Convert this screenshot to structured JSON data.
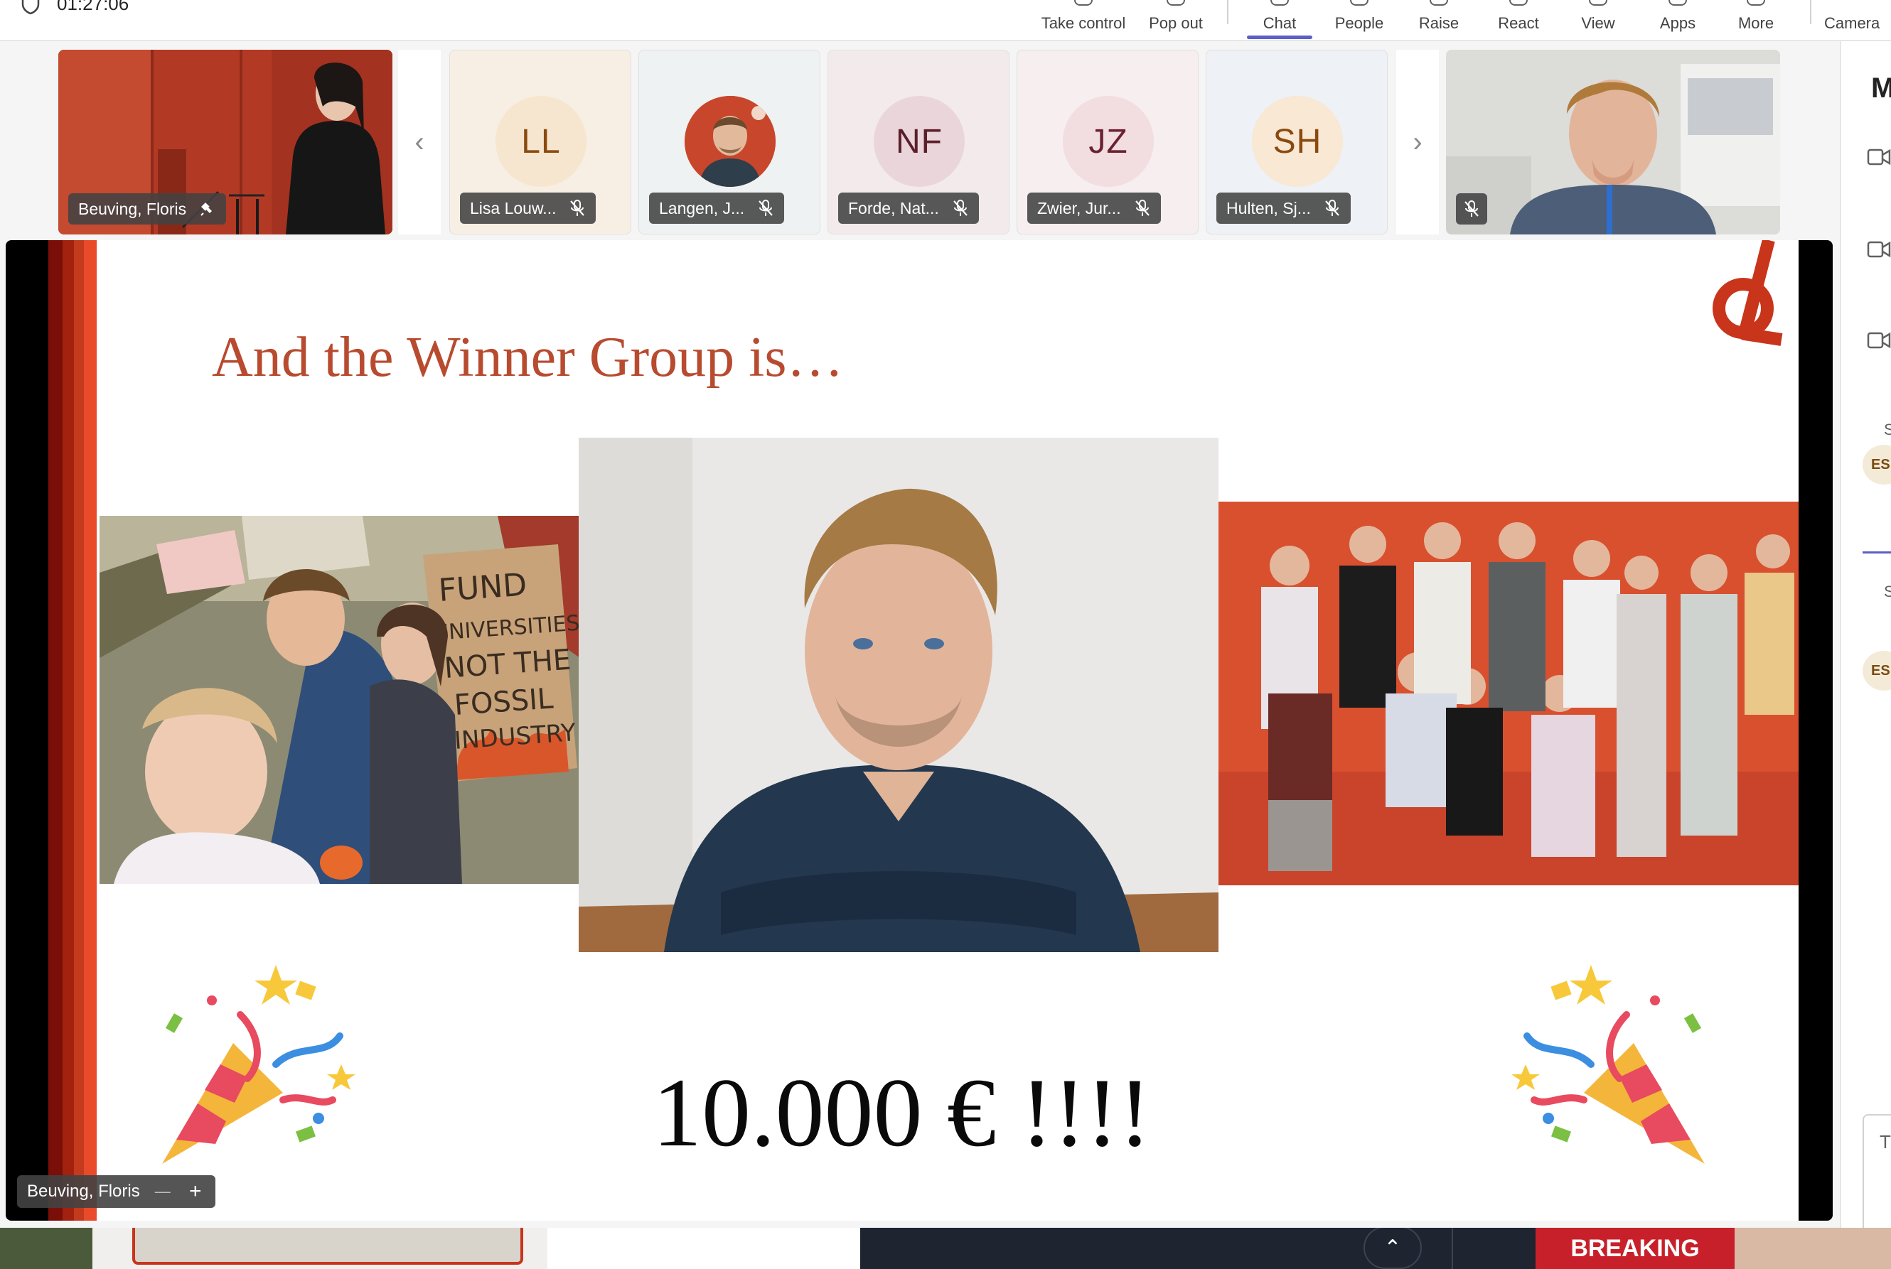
{
  "meeting": {
    "timer": "01:27:06"
  },
  "toolbar": {
    "items": [
      {
        "label": "Take control"
      },
      {
        "label": "Pop out"
      },
      {
        "label": "Chat"
      },
      {
        "label": "People"
      },
      {
        "label": "Raise"
      },
      {
        "label": "React"
      },
      {
        "label": "View"
      },
      {
        "label": "Apps"
      },
      {
        "label": "More"
      },
      {
        "label": "Camera"
      }
    ]
  },
  "participants": {
    "pinned": {
      "name": "Beuving, Floris"
    },
    "tiles": [
      {
        "initials": "LL",
        "name": "Lisa Louw...",
        "bg": "#f7efe3",
        "circle": "#f6e6cf",
        "color": "#8a4a0f"
      },
      {
        "initials": "",
        "name": "Langen, J...",
        "bg": "#eef2f2",
        "circle": "#c8472c",
        "color": "#ffffff"
      },
      {
        "initials": "NF",
        "name": "Forde, Nat...",
        "bg": "#f3eaec",
        "circle": "#ead6da",
        "color": "#5a1f2a"
      },
      {
        "initials": "JZ",
        "name": "Zwier, Jur...",
        "bg": "#f6eeef",
        "circle": "#f2dde0",
        "color": "#6b2130"
      },
      {
        "initials": "SH",
        "name": "Hulten, Sj...",
        "bg": "#eef1f5",
        "circle": "#f8e8d4",
        "color": "#8a4a0f"
      }
    ]
  },
  "right_panel": {
    "heading_initial": "M",
    "badge": "ES",
    "letter_s": "S",
    "letter_t": "T"
  },
  "slide": {
    "title": "And the Winner Group is…",
    "prize": "10.000 € !!!!",
    "poster_lines": [
      "FUND",
      "UNIVERSITIES",
      "NOT THE",
      "FOSSIL",
      "INDUSTRY"
    ],
    "accent": "#b84b2f"
  },
  "screen_share": {
    "presenter": "Beuving, Floris",
    "zoom_out": "—",
    "zoom_in": "+"
  },
  "bottom": {
    "breaking": "BREAKING"
  }
}
